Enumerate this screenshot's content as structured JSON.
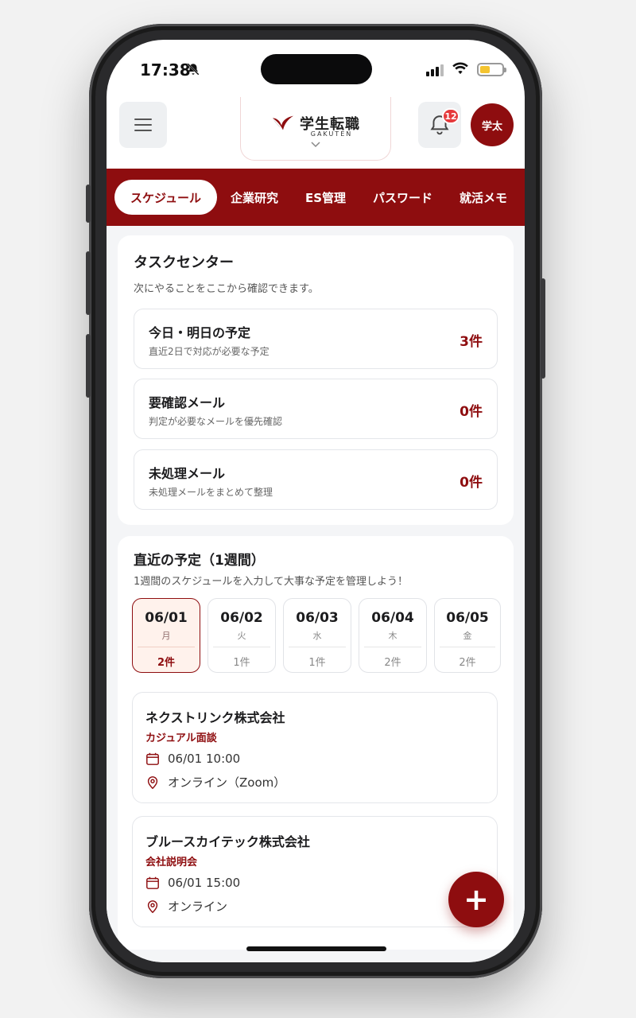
{
  "status_bar": {
    "time": "17:38"
  },
  "header": {
    "logo_text": "学生転職",
    "logo_sub": "GAKUTEN",
    "notification_count": "12",
    "avatar_label": "学太"
  },
  "tabs": [
    {
      "label": "スケジュール",
      "active": true
    },
    {
      "label": "企業研究"
    },
    {
      "label": "ES管理"
    },
    {
      "label": "パスワード"
    },
    {
      "label": "就活メモ"
    }
  ],
  "task_center": {
    "title": "タスクセンター",
    "subtitle": "次にやることをここから確認できます。",
    "items": [
      {
        "title": "今日・明日の予定",
        "desc": "直近2日で対応が必要な予定",
        "count": "3件"
      },
      {
        "title": "要確認メール",
        "desc": "判定が必要なメールを優先確認",
        "count": "0件"
      },
      {
        "title": "未処理メール",
        "desc": "未処理メールをまとめて整理",
        "count": "0件"
      }
    ]
  },
  "schedule": {
    "title": "直近の予定（1週間）",
    "subtitle": "1週間のスケジュールを入力して大事な予定を管理しよう！",
    "days": [
      {
        "date": "06/01",
        "weekday": "月",
        "count": "2件",
        "active": true
      },
      {
        "date": "06/02",
        "weekday": "火",
        "count": "1件"
      },
      {
        "date": "06/03",
        "weekday": "水",
        "count": "1件"
      },
      {
        "date": "06/04",
        "weekday": "木",
        "count": "2件"
      },
      {
        "date": "06/05",
        "weekday": "金",
        "count": "2件"
      }
    ],
    "events": [
      {
        "company": "ネクストリンク株式会社",
        "type": "カジュアル面談",
        "datetime": "06/01 10:00",
        "location": "オンライン（Zoom）"
      },
      {
        "company": "ブルースカイテック株式会社",
        "type": "会社説明会",
        "datetime": "06/01 15:00",
        "location": "オンライン"
      }
    ]
  },
  "fab_label": "+",
  "colors": {
    "accent": "#8e0d0f",
    "badge": "#e5393b",
    "active_day_bg": "#fff2ec"
  }
}
